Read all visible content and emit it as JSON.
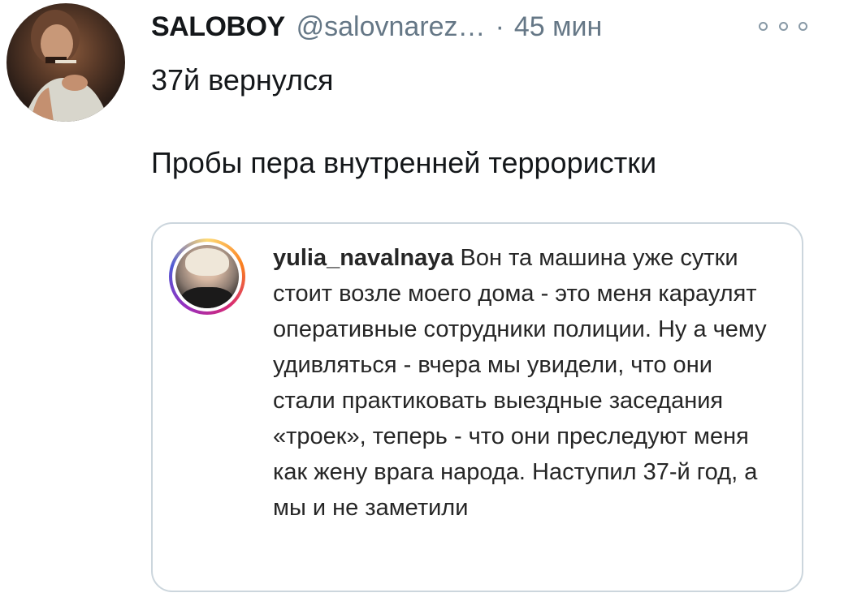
{
  "tweet": {
    "display_name": "SALOBOY",
    "handle": "@salovnarez…",
    "separator": "·",
    "time": "45 мин",
    "text_line1": "37й вернулся",
    "text_line2": "Пробы пера внутренней террористки"
  },
  "quoted_post": {
    "username": "yulia_navalnaya",
    "text": "Вон та машина уже сутки стоит возле моего дома - это меня караулят оперативные сотрудники полиции. Ну а чему удивляться - вчера мы увидели, что они стали практиковать выездные заседания «троек», теперь - что они преследуют меня как жену врага народа. Наступил 37-й год, а мы и не заметили"
  },
  "icons": {
    "more": "more-options-icon"
  },
  "colors": {
    "text_primary": "#14171a",
    "text_secondary": "#657786",
    "card_border": "#ccd6dd"
  }
}
